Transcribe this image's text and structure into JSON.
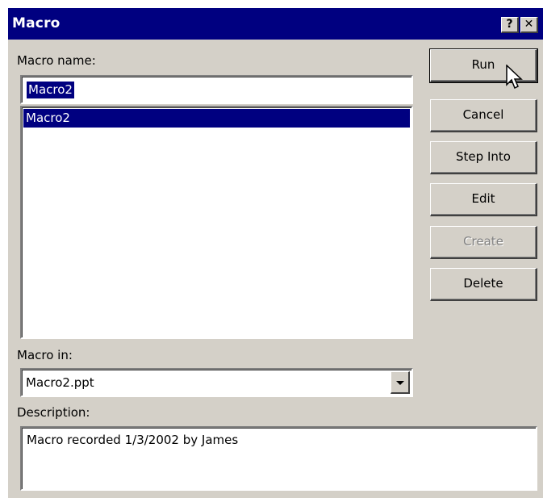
{
  "window": {
    "title": "Macro",
    "help_label": "?",
    "close_label": "✕"
  },
  "form": {
    "macro_name_label": "Macro name:",
    "macro_name_value": "Macro2",
    "macros": [
      "Macro2"
    ],
    "macro_in_label": "Macro in:",
    "macro_in_value": "Macro2.ppt",
    "description_label": "Description:",
    "description_value": "Macro recorded 1/3/2002 by James"
  },
  "buttons": {
    "run": "Run",
    "cancel": "Cancel",
    "step_into": "Step Into",
    "edit": "Edit",
    "create": "Create",
    "delete": "Delete"
  },
  "icons": {
    "cursor": "arrow-cursor-icon",
    "dropdown": "dropdown-arrow-icon"
  },
  "colors": {
    "title_bar": "#000080",
    "selection": "#000080",
    "dialog_face": "#d4d0c8"
  }
}
